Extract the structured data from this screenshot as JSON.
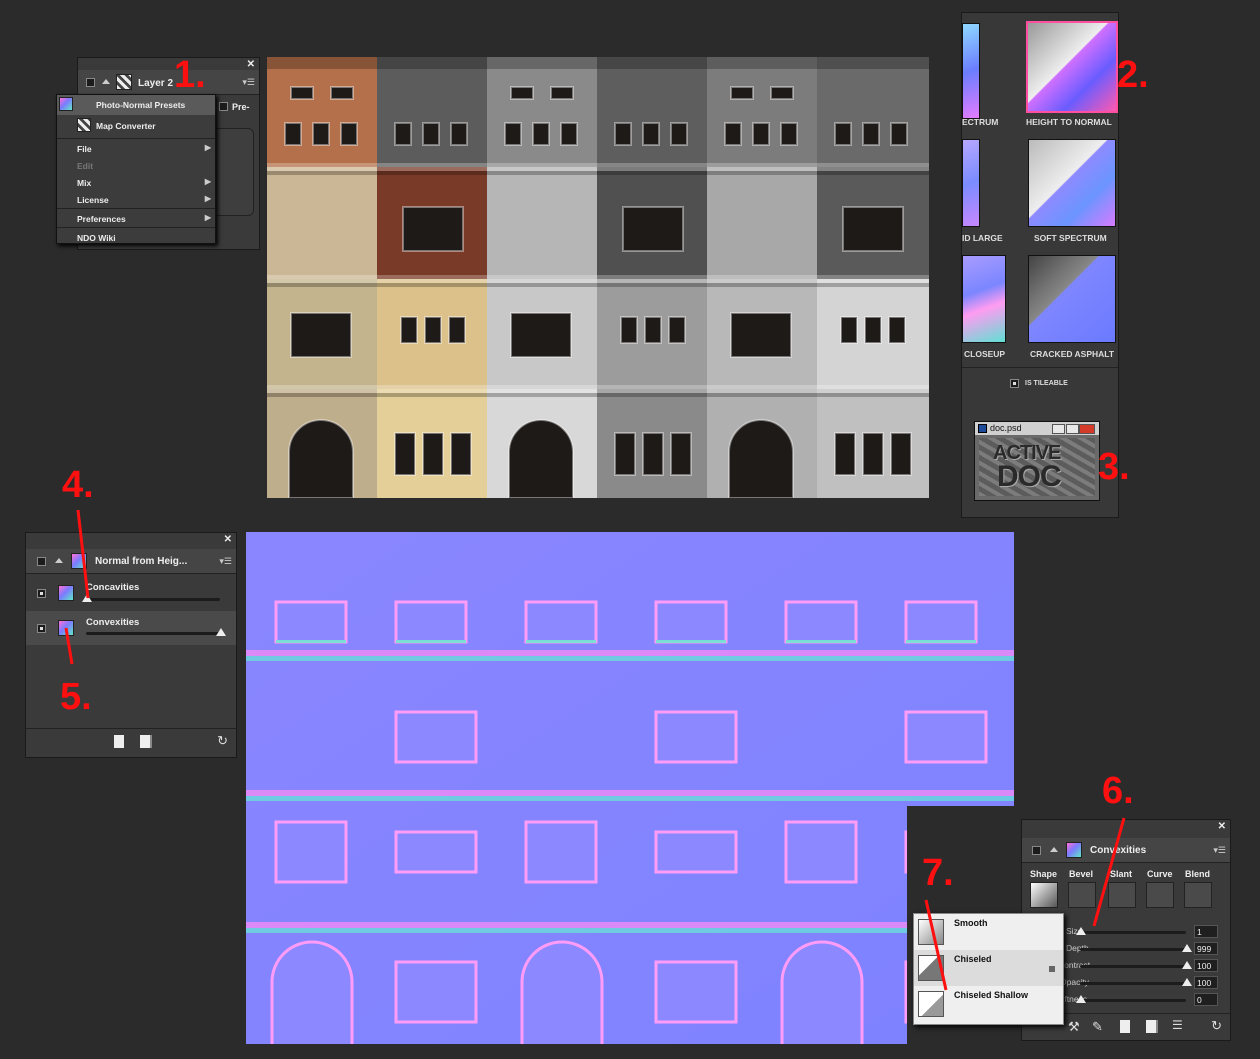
{
  "layer_panel": {
    "tab_label": "Layer 2",
    "partial_label": "Pre-",
    "menu": {
      "photo_normal_presets": "Photo-Normal Presets",
      "map_converter": "Map Converter",
      "file": "File",
      "edit": "Edit",
      "mix": "Mix",
      "license": "License",
      "preferences": "Preferences",
      "ndo_wiki": "NDO Wiki"
    }
  },
  "presets_panel": {
    "items": [
      "ECTRUM",
      "HEIGHT TO NORMAL",
      "ID LARGE",
      "SOFT SPECTRUM",
      "CLOSEUP",
      "CRACKED ASPHALT"
    ],
    "tileable_label": "IS TILEABLE",
    "active_doc": {
      "filename": "doc.psd",
      "line1": "ACTIVE",
      "line2": "DOC"
    }
  },
  "normal_panel": {
    "tab_label": "Normal from Heig...",
    "layers": [
      {
        "label": "Concavities",
        "slider": 0.0
      },
      {
        "label": "Convexities",
        "slider": 1.0
      }
    ]
  },
  "convexities_panel": {
    "tab_label": "Convexities",
    "tools": [
      "Shape",
      "Bevel",
      "Slant",
      "Curve",
      "Blend"
    ],
    "params": [
      {
        "label": "Size",
        "value": "1",
        "slider": 0.0
      },
      {
        "label": "Depth",
        "value": "999",
        "slider": 1.0
      },
      {
        "label": "Contrast",
        "value": "100",
        "slider": 1.0
      },
      {
        "label": "Opacity",
        "value": "100",
        "slider": 1.0
      },
      {
        "label": "Softness",
        "value": "0",
        "slider": 0.0
      }
    ]
  },
  "bevel_dropdown": {
    "items": [
      "Smooth",
      "Chiseled",
      "Chiseled Shallow"
    ]
  },
  "annotations": [
    "1.",
    "2.",
    "3.",
    "4.",
    "5.",
    "6.",
    "7."
  ],
  "colors": {
    "annotation": "#ff1010",
    "background": "#2b2b2b",
    "panel": "#3a3a3a"
  }
}
